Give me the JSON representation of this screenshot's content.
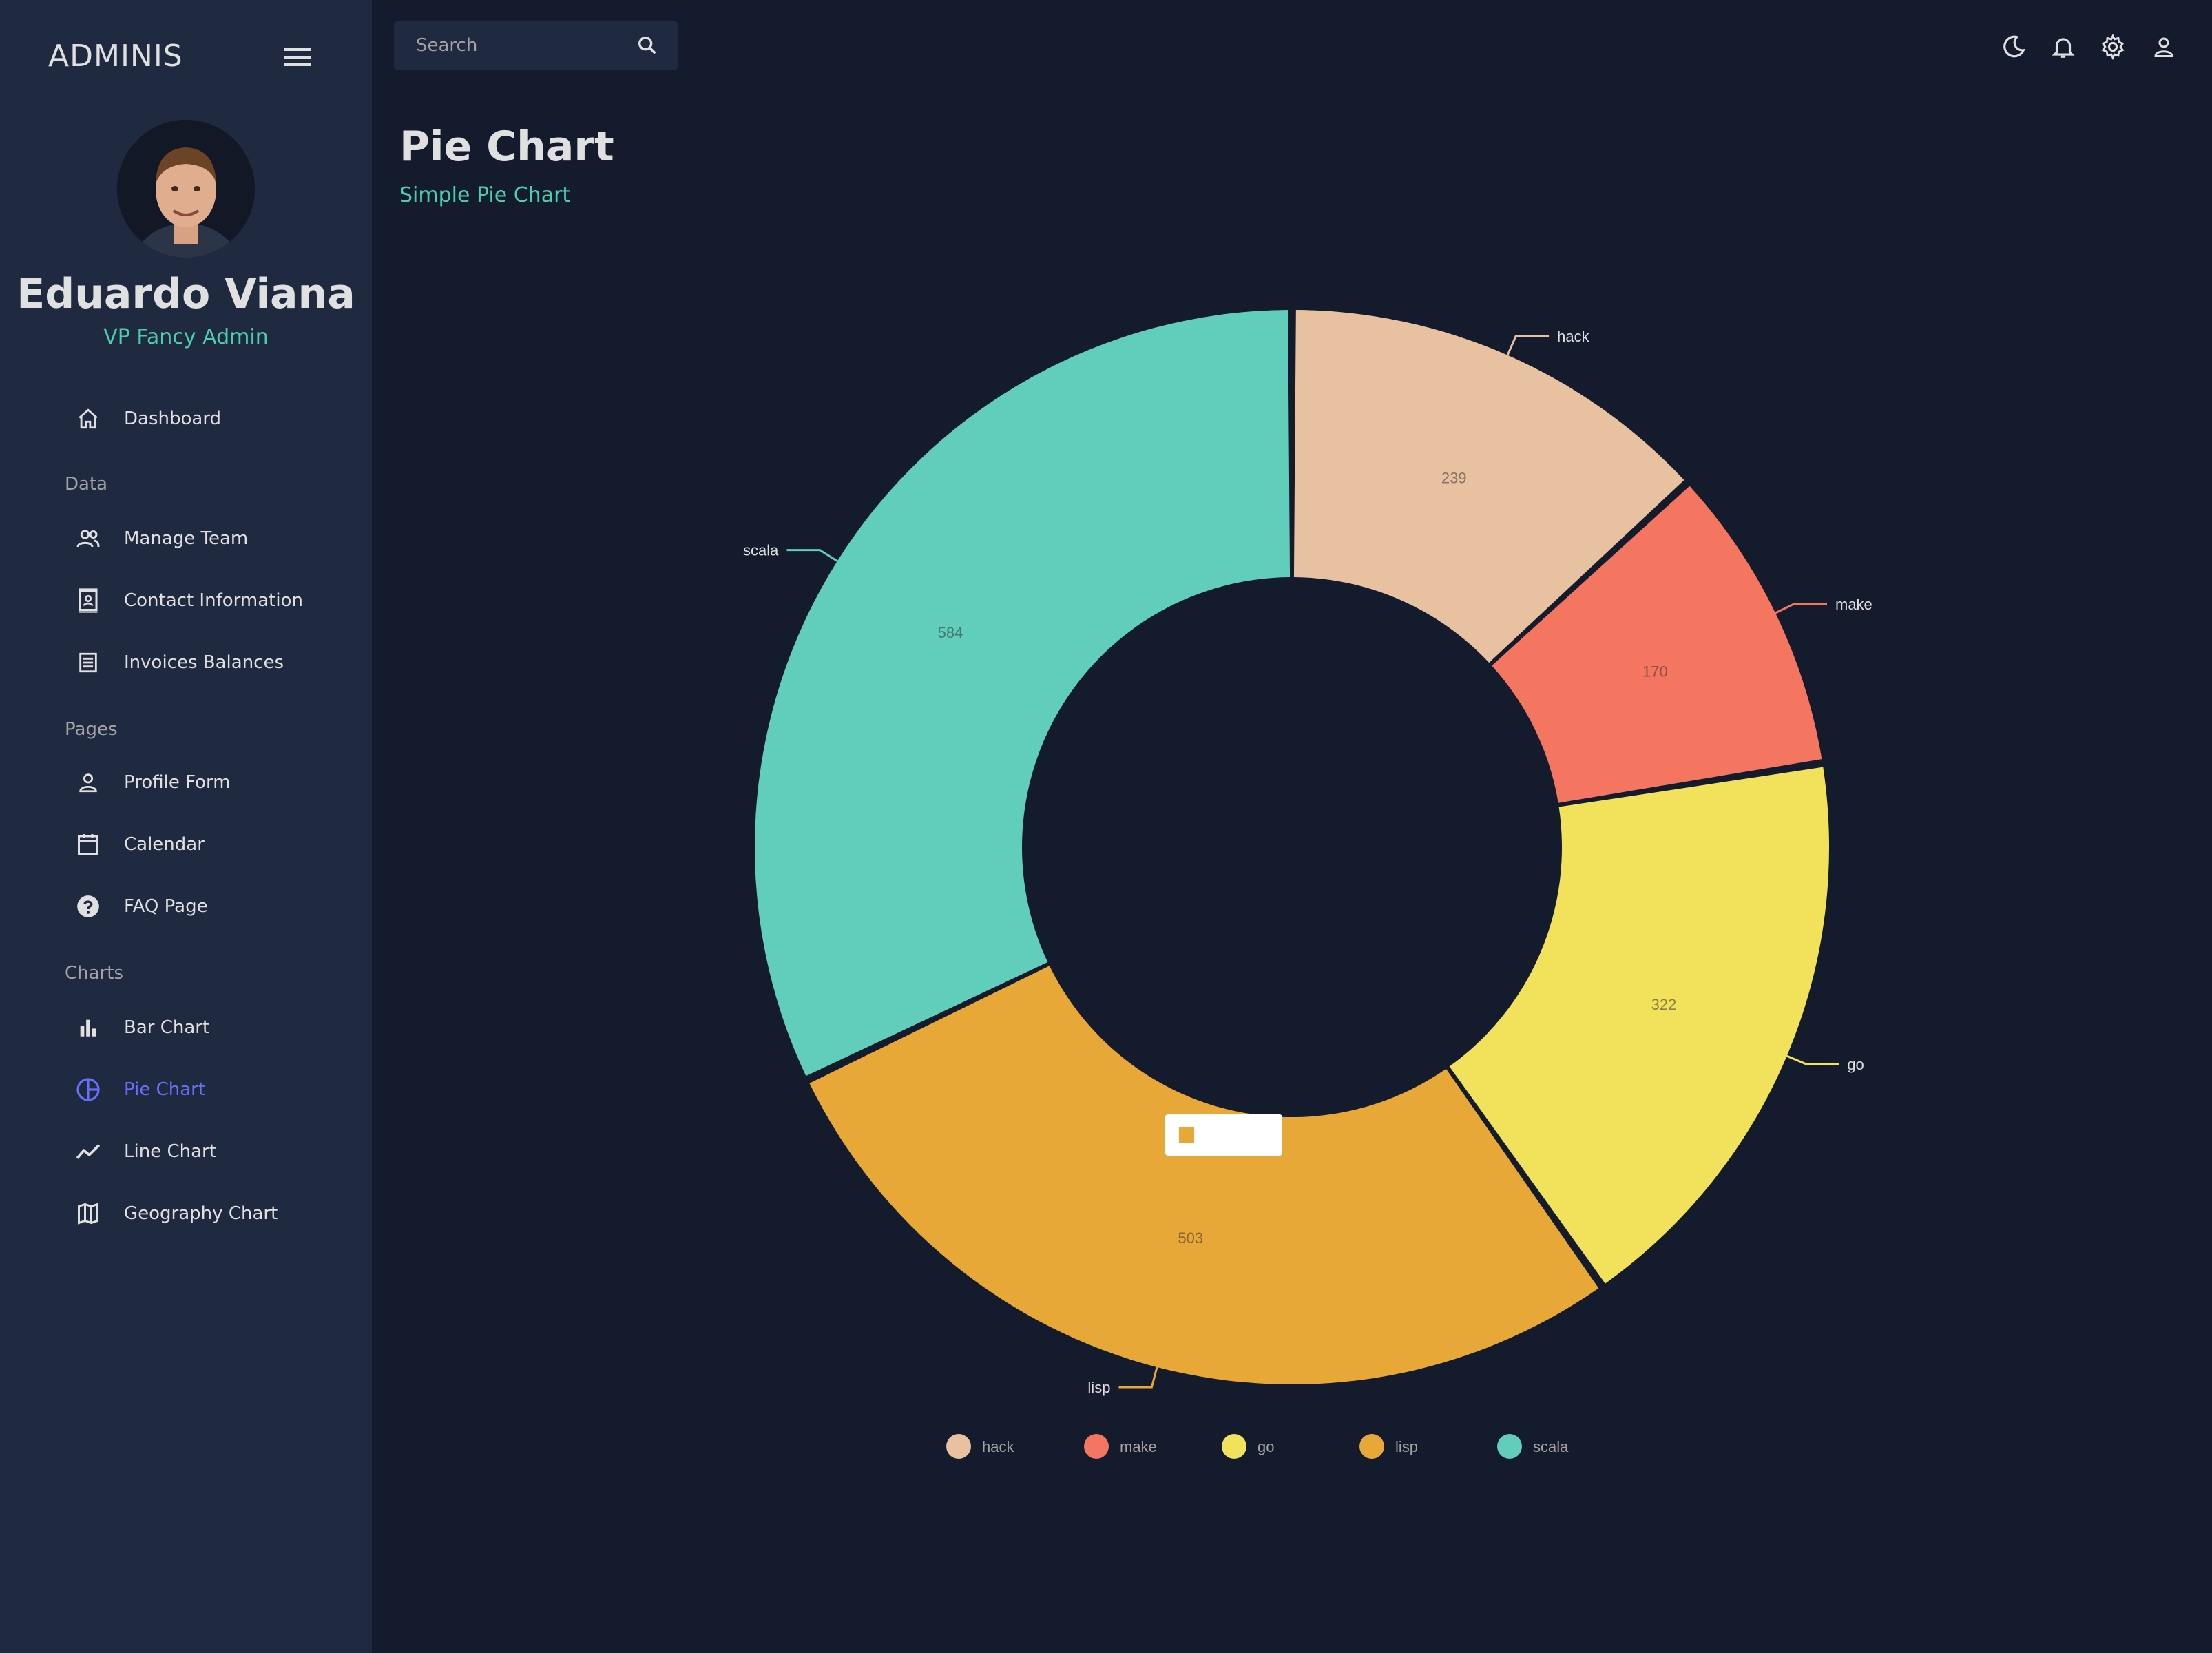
{
  "sidebar": {
    "brand": "ADMINIS",
    "profile": {
      "name": "Eduardo Viana",
      "role": "VP Fancy Admin"
    },
    "items": {
      "dashboard": "Dashboard",
      "section_data": "Data",
      "manage_team": "Manage Team",
      "contact_information": "Contact Information",
      "invoices_balances": "Invoices Balances",
      "section_pages": "Pages",
      "profile_form": "Profile Form",
      "calendar": "Calendar",
      "faq_page": "FAQ Page",
      "section_charts": "Charts",
      "bar_chart": "Bar Chart",
      "pie_chart": "Pie Chart",
      "line_chart": "Line Chart",
      "geography_chart": "Geography Chart"
    },
    "active_item": "pie_chart"
  },
  "topbar": {
    "search_placeholder": "Search",
    "icons": [
      "search-icon",
      "dark-mode-icon",
      "bell-icon",
      "gear-icon",
      "user-icon"
    ]
  },
  "header": {
    "title": "Pie Chart",
    "subtitle": "Simple Pie Chart"
  },
  "colors": {
    "background": "#141b2d",
    "sidebar": "#1f2a40",
    "accent_green": "#4cceac",
    "accent_active": "#6870fa"
  },
  "chart_data": {
    "type": "pie",
    "donut": true,
    "slices": [
      {
        "label": "hack",
        "value": 239,
        "color": "#e8c1a0"
      },
      {
        "label": "make",
        "value": 170,
        "color": "#f47560"
      },
      {
        "label": "go",
        "value": 322,
        "color": "#f1e15b"
      },
      {
        "label": "lisp",
        "value": 503,
        "color": "#e8a838"
      },
      {
        "label": "scala",
        "value": 584,
        "color": "#61cdbb"
      }
    ],
    "legend": [
      "hack",
      "make",
      "go",
      "lisp",
      "scala"
    ],
    "legend_position": "bottom",
    "tooltip_color": "#e8a838"
  }
}
